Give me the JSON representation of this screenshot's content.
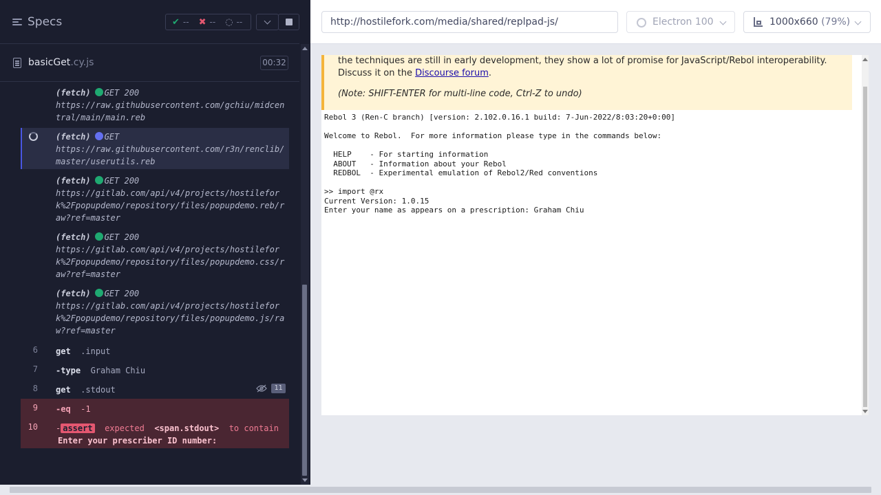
{
  "reporter": {
    "specs_title": "Specs",
    "stats": {
      "passed": "--",
      "failed": "--",
      "pending": "--"
    },
    "spec": {
      "name": "basicGet",
      "ext": ".cy.js",
      "duration": "00:32"
    },
    "commands": [
      {
        "type": "fetch",
        "label": "(fetch)",
        "status": "GET 200",
        "state": "success",
        "url": "https://raw.githubusercontent.com/gchiu/midcentral/main/main.reb"
      },
      {
        "type": "fetch",
        "label": "(fetch)",
        "status": "GET",
        "state": "pending",
        "url": "https://raw.githubusercontent.com/r3n/renclib/master/userutils.reb"
      },
      {
        "type": "fetch",
        "label": "(fetch)",
        "status": "GET 200",
        "state": "success",
        "url": "https://gitlab.com/api/v4/projects/hostilefork%2Fpopupdemo/repository/files/popupdemo.reb/raw?ref=master"
      },
      {
        "type": "fetch",
        "label": "(fetch)",
        "status": "GET 200",
        "state": "success",
        "url": "https://gitlab.com/api/v4/projects/hostilefork%2Fpopupdemo/repository/files/popupdemo.css/raw?ref=master"
      },
      {
        "type": "fetch",
        "label": "(fetch)",
        "status": "GET 200",
        "state": "success",
        "url": "https://gitlab.com/api/v4/projects/hostilefork%2Fpopupdemo/repository/files/popupdemo.js/raw?ref=master"
      },
      {
        "num": "6",
        "name": "get",
        "arg": ".input"
      },
      {
        "num": "7",
        "name": "-type",
        "arg": "Graham Chiu"
      },
      {
        "num": "8",
        "name": "get",
        "arg": ".stdout",
        "count": "11"
      },
      {
        "num": "9",
        "name": "-eq",
        "arg": "-1"
      },
      {
        "num": "10",
        "name": "-",
        "badge": "assert",
        "msg_pre": "expected",
        "msg_el": "<span.stdout>",
        "msg_mid": "to contain",
        "msg_val": "Enter your prescriber ID number:"
      }
    ]
  },
  "aut": {
    "url": "http://hostilefork.com/media/shared/replpad-js/",
    "browser": "Electron 100",
    "viewport": "1000x660",
    "scale": "(79%)",
    "note_text": "the techniques are still in early development, they show a lot of promise for JavaScript/Rebol interoperability. Discuss it on the",
    "note_link": "Discourse forum",
    "note_end": ".",
    "note_hint": "(Note: SHIFT-ENTER for multi-line code, Ctrl-Z to undo)",
    "console_text": "Rebol 3 (Ren-C branch) [version: 2.102.0.16.1 build: 7-Jun-2022/8:03:20+0:00]\n\nWelcome to Rebol.  For more information please type in the commands below:\n\n  HELP    - For starting information\n  ABOUT   - Information about your Rebol\n  REDBOL  - Experimental emulation of Rebol2/Red conventions\n\n>> import @rx\nCurrent Version: 1.0.15\nEnter your name as appears on a prescription: Graham Chiu"
  },
  "colors": {
    "success": "#1fa971",
    "pending": "#6470f0",
    "failed": "#e45770",
    "warning": "#f4b43a"
  }
}
